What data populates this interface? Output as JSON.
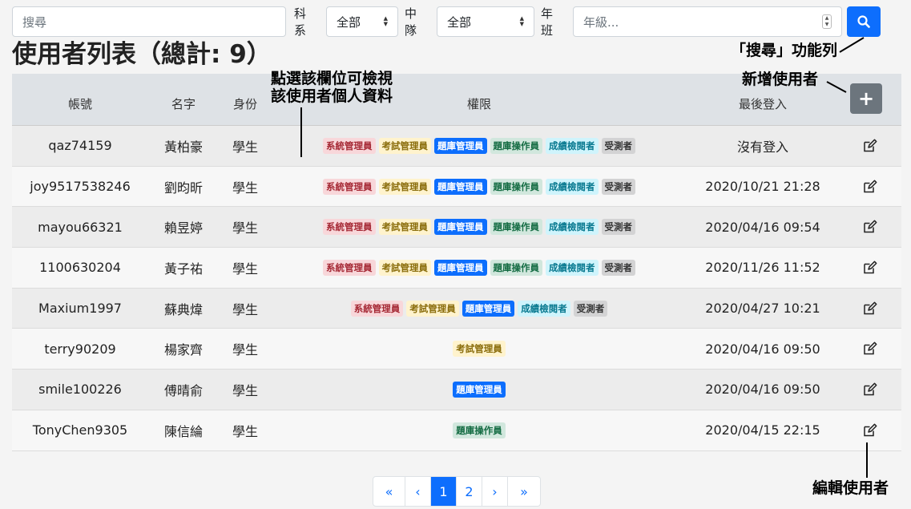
{
  "search": {
    "placeholder": "搜尋",
    "dept_label": "科系",
    "dept_value": "全部",
    "squad_label": "中隊",
    "squad_value": "全部",
    "class_label": "年班",
    "class_placeholder": "年級..."
  },
  "page": {
    "title": "使用者列表（總計: 9）"
  },
  "table": {
    "headers": {
      "account": "帳號",
      "name": "名字",
      "role": "身份",
      "permissions": "權限",
      "last_login": "最後登入"
    },
    "add_label": "+"
  },
  "badge_styles": {
    "系統管理員": "b-sys",
    "考試管理員": "b-exam",
    "題庫管理員": "b-bank",
    "題庫操作員": "b-op",
    "成績檢閱者": "b-grade",
    "受測者": "b-test"
  },
  "users": [
    {
      "account": "qaz74159",
      "name": "黃柏豪",
      "role": "學生",
      "perms": [
        "系統管理員",
        "考試管理員",
        "題庫管理員",
        "題庫操作員",
        "成績檢閱者",
        "受測者"
      ],
      "last_login": "沒有登入"
    },
    {
      "account": "joy9517538246",
      "name": "劉昀昕",
      "role": "學生",
      "perms": [
        "系統管理員",
        "考試管理員",
        "題庫管理員",
        "題庫操作員",
        "成績檢閱者",
        "受測者"
      ],
      "last_login": "2020/10/21 21:28"
    },
    {
      "account": "mayou66321",
      "name": "賴昱婷",
      "role": "學生",
      "perms": [
        "系統管理員",
        "考試管理員",
        "題庫管理員",
        "題庫操作員",
        "成績檢閱者",
        "受測者"
      ],
      "last_login": "2020/04/16 09:54"
    },
    {
      "account": "1100630204",
      "name": "黃子祐",
      "role": "學生",
      "perms": [
        "系統管理員",
        "考試管理員",
        "題庫管理員",
        "題庫操作員",
        "成績檢閱者",
        "受測者"
      ],
      "last_login": "2020/11/26 11:52"
    },
    {
      "account": "Maxium1997",
      "name": "蘇典煒",
      "role": "學生",
      "perms": [
        "系統管理員",
        "考試管理員",
        "題庫管理員",
        "成績檢閱者",
        "受測者"
      ],
      "last_login": "2020/04/27 10:21"
    },
    {
      "account": "terry90209",
      "name": "楊家齊",
      "role": "學生",
      "perms": [
        "考試管理員"
      ],
      "last_login": "2020/04/16 09:50"
    },
    {
      "account": "smile100226",
      "name": "傅晴俞",
      "role": "學生",
      "perms": [
        "題庫管理員"
      ],
      "last_login": "2020/04/16 09:50"
    },
    {
      "account": "TonyChen9305",
      "name": "陳信綸",
      "role": "學生",
      "perms": [
        "題庫操作員"
      ],
      "last_login": "2020/04/15 22:15"
    }
  ],
  "pagination": {
    "first": "«",
    "prev": "‹",
    "pages": [
      "1",
      "2"
    ],
    "next": "›",
    "last": "»",
    "current": "1"
  },
  "annotations": {
    "click_cell_1": "點選該欄位可檢視",
    "click_cell_2": "該使用者個人資料",
    "search_bar": "「搜尋」功能列",
    "add_user": "新增使用者",
    "edit_user": "編輯使用者"
  },
  "colors": {
    "primary": "#0d6efd",
    "secondary": "#6c757d",
    "header_bg": "#dee2e6"
  },
  "icons": {
    "search": "search-icon",
    "add": "plus-icon",
    "edit": "edit-icon"
  }
}
